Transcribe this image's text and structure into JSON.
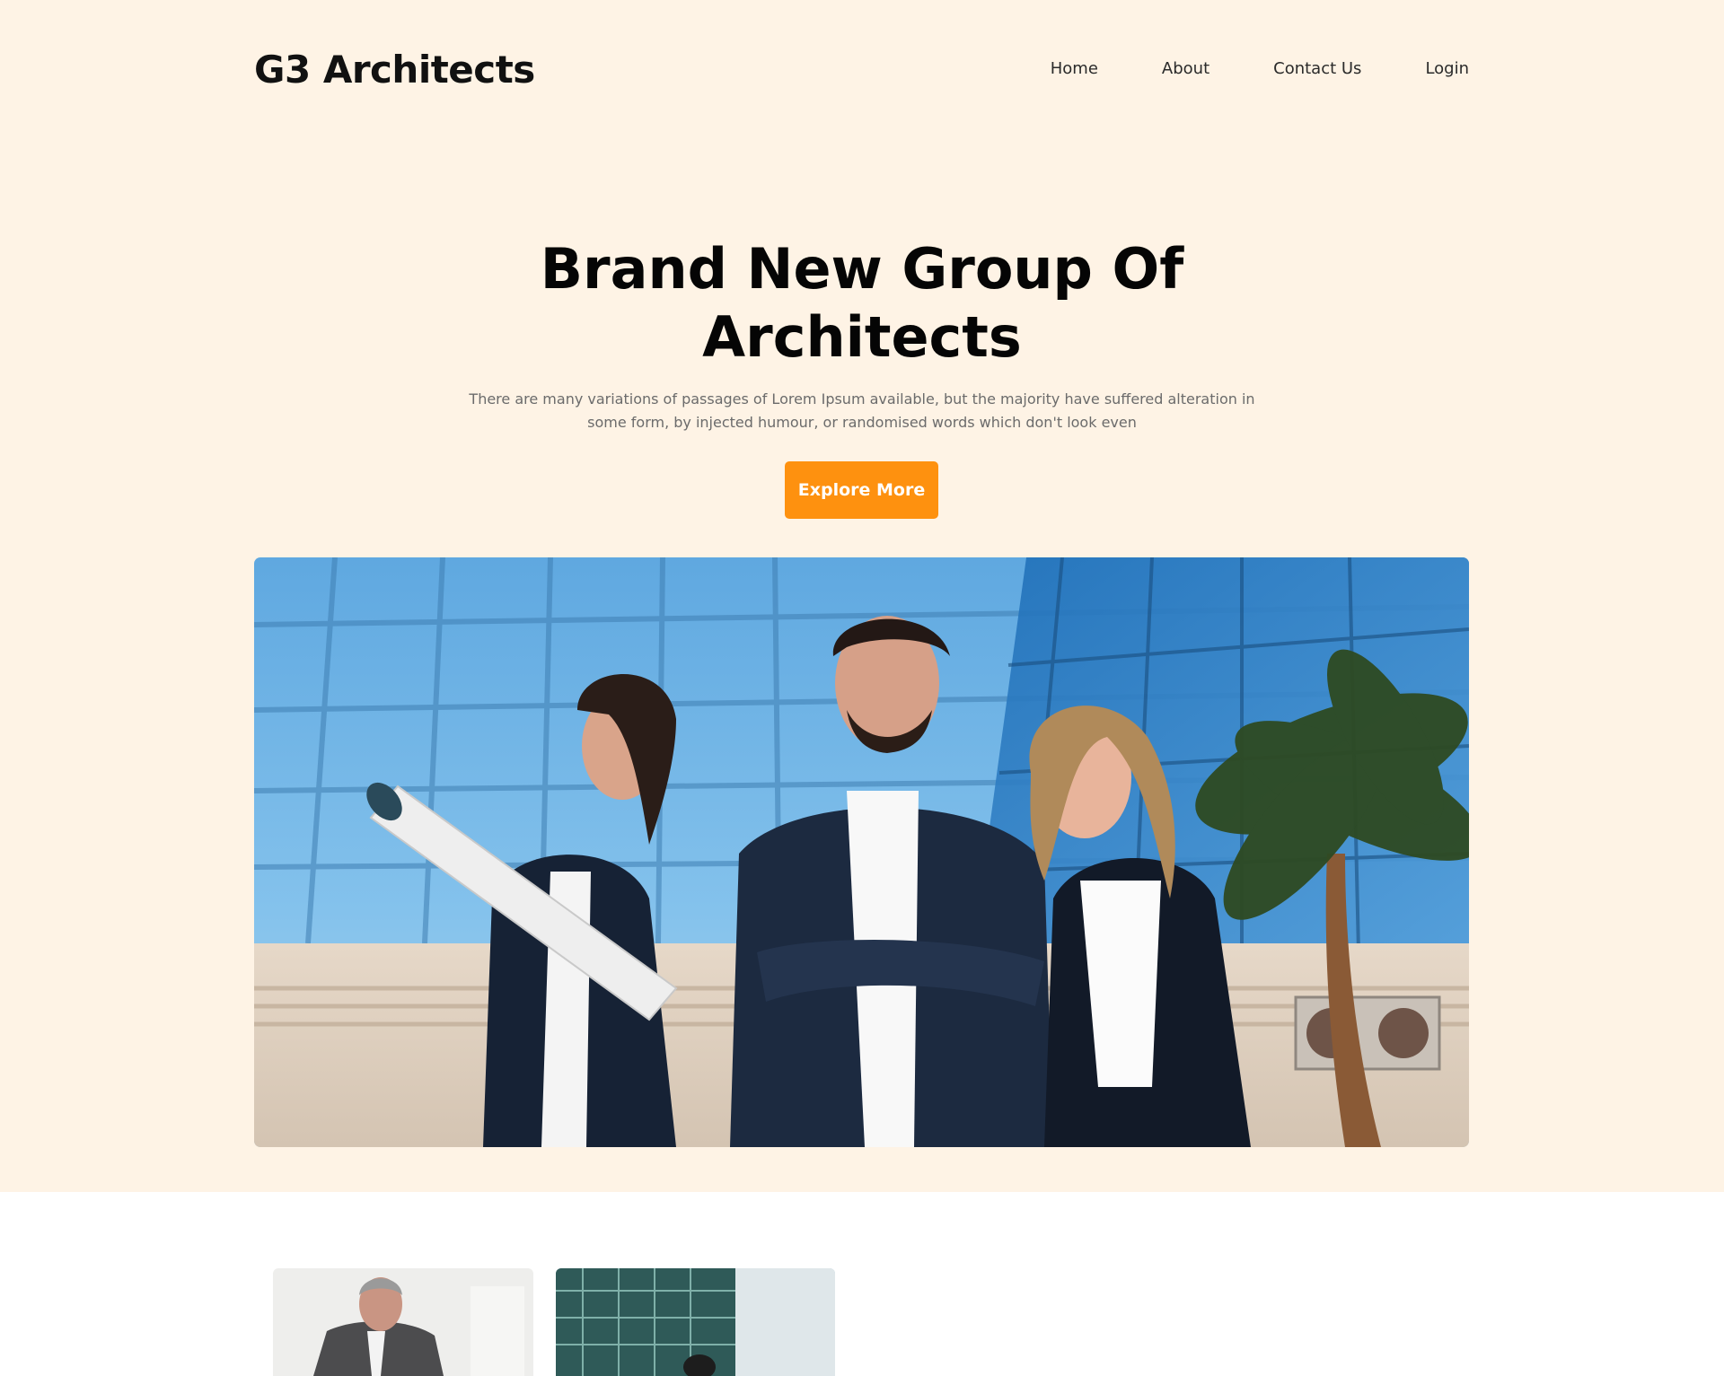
{
  "header": {
    "logo": "G3 Architects",
    "nav": [
      {
        "label": "Home"
      },
      {
        "label": "About"
      },
      {
        "label": "Contact Us"
      },
      {
        "label": "Login"
      }
    ]
  },
  "hero": {
    "title_line1": "Brand New Group Of",
    "title_line2": "Architects",
    "description": "There are many variations of passages of Lorem Ipsum available, but the majority have suffered alteration in some form, by injected humour, or randomised words which don't look even",
    "cta_label": "Explore More"
  },
  "colors": {
    "hero_background": "#fef3e5",
    "accent": "#fe910f",
    "page_background": "#ffffff"
  }
}
